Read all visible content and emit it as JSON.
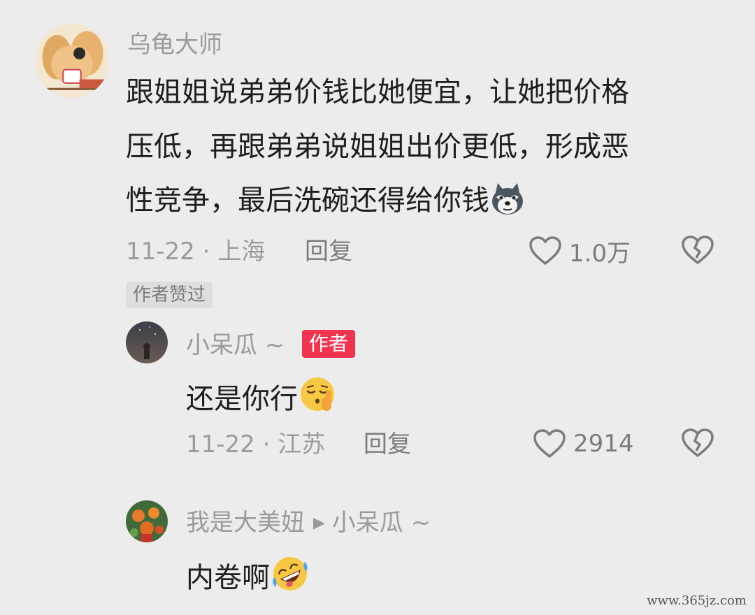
{
  "comment1": {
    "username": "乌龟大师",
    "lines": [
      "跟姐姐说弟弟价钱比她便宜，让她把价格",
      "压低，再跟弟弟说姐姐出价更低，形成恶",
      "性竞争，最后洗碗还得给你钱"
    ],
    "emoji": "husky-emoji",
    "date_location": "11-22 · 上海",
    "reply_label": "回复",
    "like_count": "1.0万",
    "author_liked_badge": "作者赞过"
  },
  "reply1": {
    "username": "小呆瓜 ~",
    "author_badge": "作者",
    "text": "还是你行",
    "emoji": "shushing-face-emoji",
    "date_location": "11-22 · 江苏",
    "reply_label": "回复",
    "like_count": "2914"
  },
  "reply2": {
    "username": "我是大美妞",
    "reply_to": "小呆瓜 ~",
    "text": "内卷啊",
    "emoji": "rolling-laughing-emoji"
  },
  "watermark": "www.365jz.com",
  "colors": {
    "background": "#ececec",
    "author_badge": "#f2344f",
    "muted_text": "#9a9a9a"
  }
}
